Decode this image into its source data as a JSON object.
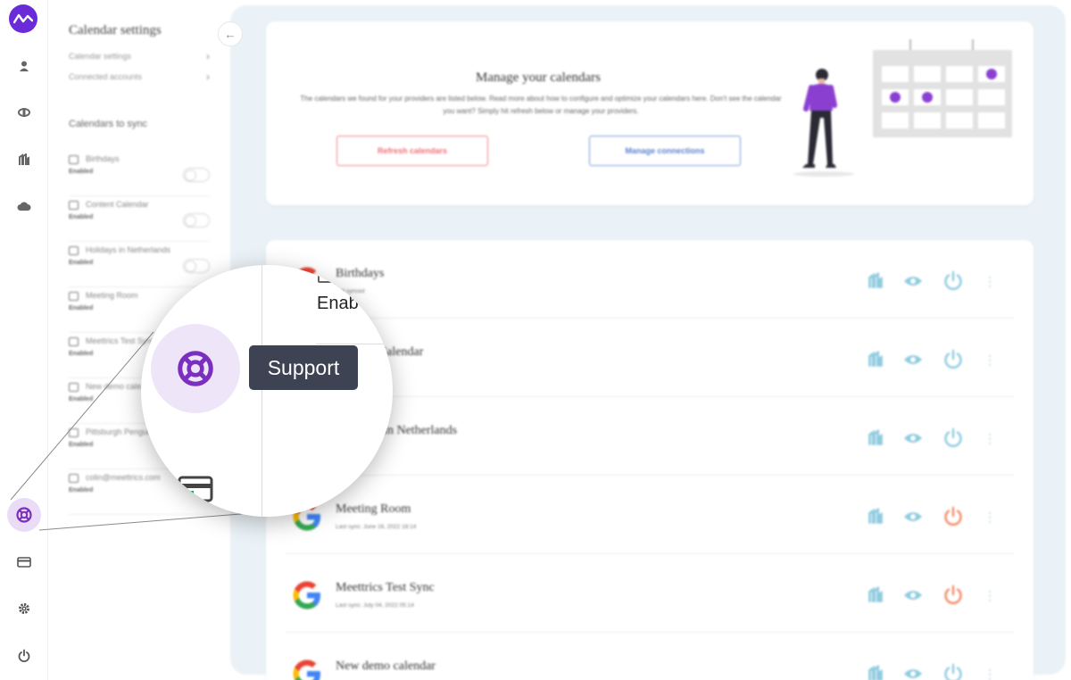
{
  "tooltip": {
    "support_label": "Support"
  },
  "panel": {
    "title": "Calendar settings",
    "links": [
      {
        "label": "Calendar settings"
      },
      {
        "label": "Connected accounts"
      }
    ],
    "section_title": "Calendars to sync",
    "calendars": [
      {
        "name": "Birthdays",
        "status": "Enabled"
      },
      {
        "name": "Content Calendar",
        "status": "Enabled"
      },
      {
        "name": "Holidays in Netherlands",
        "status": "Enabled"
      },
      {
        "name": "Meeting Room",
        "status": "Enabled"
      },
      {
        "name": "Meettrics Test Sync",
        "status": "Enabled"
      },
      {
        "name": "New demo calendar",
        "status": "Enabled"
      },
      {
        "name": "Pittsburgh Penguins",
        "status": "Enabled"
      },
      {
        "name": "colin@meettrics.com",
        "status": "Enabled"
      }
    ]
  },
  "hero": {
    "title": "Manage your calendars",
    "description": "The calendars we found for your providers are listed below. Read more about how to configure and optimize your calendars here. Don't see the calendar you want? Simply hit refresh below or manage your providers.",
    "refresh_label": "Refresh calendars",
    "manage_label": "Manage connections"
  },
  "rows": [
    {
      "name": "Birthdays",
      "sub": "Not synced",
      "provider": "google",
      "power_state": "off"
    },
    {
      "name": "Content Calendar",
      "sub": "",
      "provider": "google",
      "power_state": "off"
    },
    {
      "name": "Holidays in Netherlands",
      "sub": "Not synced",
      "provider": "google",
      "power_state": "off"
    },
    {
      "name": "Meeting Room",
      "sub": "Last sync: June 16, 2022 18:14",
      "provider": "google",
      "power_state": "on"
    },
    {
      "name": "Meettrics Test Sync",
      "sub": "Last sync: July 04, 2022 05:14",
      "provider": "google",
      "power_state": "on"
    },
    {
      "name": "New demo calendar",
      "sub": "",
      "provider": "google",
      "power_state": "off"
    }
  ],
  "magnifier": {
    "enabled_text": "Enab"
  },
  "colors": {
    "brand": "#6a2bd8",
    "support_purple": "#7b2fbf",
    "refresh_red": "#ef6e78",
    "manage_blue": "#5b80cc",
    "power_off": "#8fcbe0",
    "power_on": "#f28a66",
    "tooltip_bg": "#3d4352"
  }
}
